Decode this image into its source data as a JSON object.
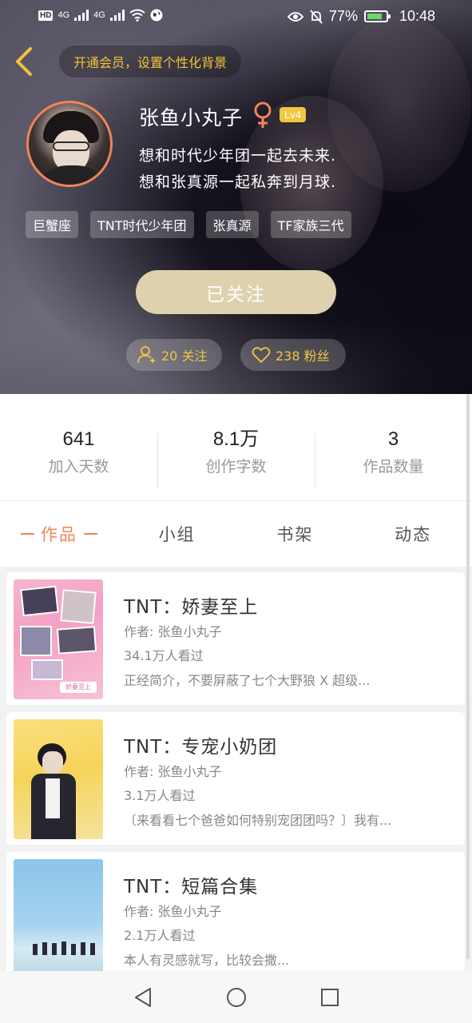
{
  "status_bar": {
    "hd_label": "HD",
    "network1": "4G",
    "network2": "4G",
    "battery_pct": "77%",
    "time": "10:48",
    "icons": [
      "signal-icon",
      "wifi-icon",
      "globe-icon",
      "eye-icon",
      "mute-bell-icon",
      "battery-icon"
    ]
  },
  "header": {
    "vip_banner": "开通会员，设置个性化背景",
    "username": "张鱼小丸子",
    "gender_icon": "female-icon",
    "level": "Lv4",
    "bio_line1": "想和时代少年团一起去未来.",
    "bio_line2": "想和张真源一起私奔到月球.",
    "tags": [
      "巨蟹座",
      "TNT时代少年团",
      "张真源",
      "TF家族三代"
    ],
    "follow_button": "已关注",
    "following": "20 关注",
    "fans": "238 粉丝"
  },
  "stats": [
    {
      "value": "641",
      "label": "加入天数"
    },
    {
      "value": "8.1万",
      "label": "创作字数"
    },
    {
      "value": "3",
      "label": "作品数量"
    }
  ],
  "tabs": [
    "作品",
    "小组",
    "书架",
    "动态"
  ],
  "active_tab": "作品",
  "books": [
    {
      "title": "TNT：娇妻至上",
      "author": "作者: 张鱼小丸子",
      "views": "34.1万人看过",
      "desc": "正经简介，不要屏蔽了七个大野狼 X 超级..."
    },
    {
      "title": "TNT：专宠小奶团",
      "author": "作者: 张鱼小丸子",
      "views": "3.1万人看过",
      "desc": "〔来看看七个爸爸如何特别宠团团吗？〕我有..."
    },
    {
      "title": "TNT：短篇合集",
      "author": "作者: 张鱼小丸子",
      "views": "2.1万人看过",
      "desc": "本人有灵感就写，比较会撒..."
    }
  ],
  "colors": {
    "accent": "#f0845a",
    "gold": "#f1c73f",
    "follow_btn": "#ded1ae"
  }
}
